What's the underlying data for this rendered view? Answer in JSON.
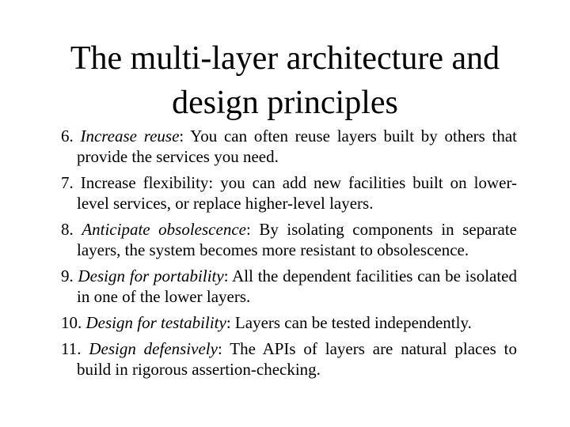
{
  "slide": {
    "title_lines": [
      "The multi-layer architecture and",
      "design principles"
    ],
    "items": [
      {
        "number": "6.",
        "term": "Increase reuse",
        "term_italic": true,
        "sep": ":",
        "text": " You can often reuse layers built by others that provide the services you need."
      },
      {
        "number": "7.",
        "term": "Increase flexibility",
        "term_italic": false,
        "sep": ":",
        "text": " you can add new facilities built on lower-level services, or replace higher-level layers."
      },
      {
        "number": "8.",
        "term": "Anticipate obsolescence",
        "term_italic": true,
        "sep": ":",
        "text": " By isolating components in separate layers, the system becomes more resistant to obsolescence."
      },
      {
        "number": "9.",
        "term": "Design for portability",
        "term_italic": true,
        "sep": ":",
        "text": " All the dependent facilities can be isolated in one of the lower layers."
      },
      {
        "number": "10.",
        "term": "Design for testability",
        "term_italic": true,
        "sep": ":",
        "text": " Layers can be tested independently."
      },
      {
        "number": "11.",
        "term": "Design defensively",
        "term_italic": true,
        "sep": ":",
        "text": " The APIs of layers are natural places to build in rigorous assertion-checking."
      }
    ]
  }
}
